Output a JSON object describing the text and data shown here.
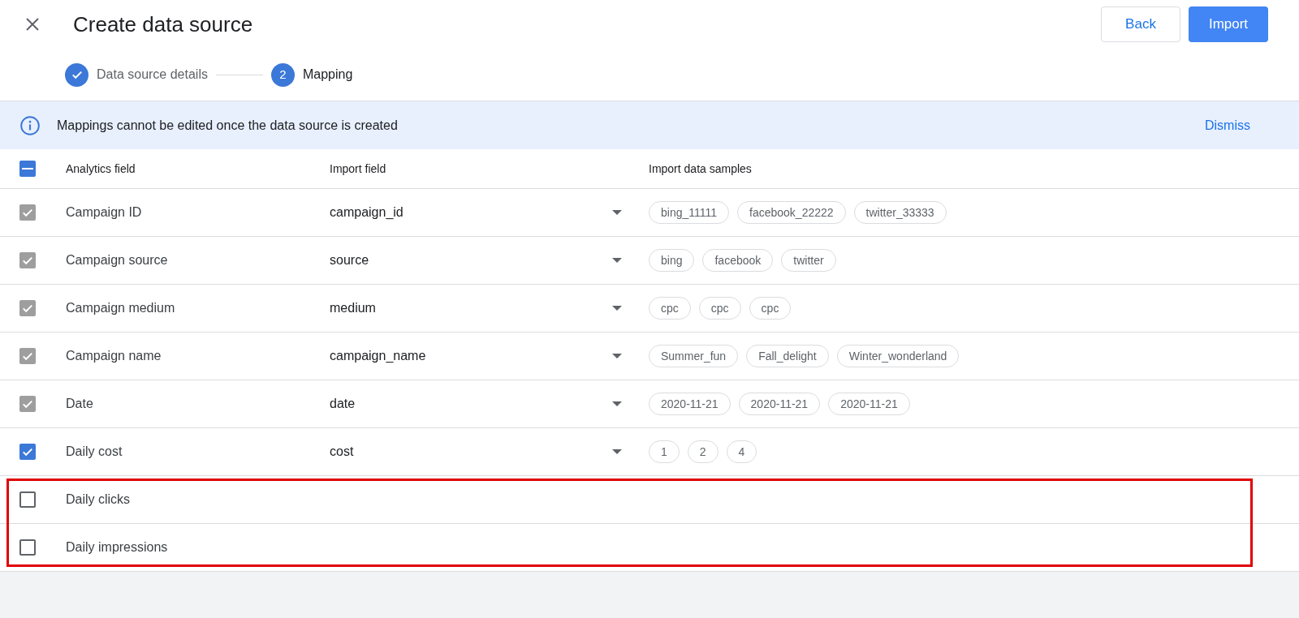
{
  "header": {
    "title": "Create data source",
    "buttons": [
      {
        "label": "Back",
        "kind": "outlined"
      },
      {
        "label": "Import",
        "kind": "filled"
      }
    ]
  },
  "steps": [
    {
      "label": "Data source details",
      "done": true,
      "selected": false
    },
    {
      "number": "2",
      "label": "Mapping",
      "done": false,
      "selected": true
    }
  ],
  "banner": {
    "message": "Mappings cannot be edited once the data source is created",
    "action": "Dismiss"
  },
  "table": {
    "select_all": {
      "checked": true,
      "indeterminate": true
    },
    "columns": [
      "Analytics field",
      "Import field",
      "Import data samples"
    ],
    "rows": [
      {
        "checked": true,
        "disabled": true,
        "highlighted": false,
        "analytics_field": "Campaign ID",
        "import_field": "campaign_id",
        "samples": [
          "bing_11111",
          "facebook_22222",
          "twitter_33333"
        ]
      },
      {
        "checked": true,
        "disabled": true,
        "highlighted": false,
        "analytics_field": "Campaign source",
        "import_field": "source",
        "samples": [
          "bing",
          "facebook",
          "twitter"
        ]
      },
      {
        "checked": true,
        "disabled": true,
        "highlighted": false,
        "analytics_field": "Campaign medium",
        "import_field": "medium",
        "samples": [
          "cpc",
          "cpc",
          "cpc"
        ]
      },
      {
        "checked": true,
        "disabled": true,
        "highlighted": false,
        "analytics_field": "Campaign name",
        "import_field": "campaign_name",
        "samples": [
          "Summer_fun",
          "Fall_delight",
          "Winter_wonderland"
        ]
      },
      {
        "checked": true,
        "disabled": true,
        "highlighted": false,
        "analytics_field": "Date",
        "import_field": "date",
        "samples": [
          "2020-11-21",
          "2020-11-21",
          "2020-11-21"
        ]
      },
      {
        "checked": true,
        "disabled": false,
        "highlighted": false,
        "analytics_field": "Daily cost",
        "import_field": "cost",
        "samples": [
          "1",
          "2",
          "4"
        ]
      },
      {
        "checked": false,
        "disabled": false,
        "highlighted": true,
        "analytics_field": "Daily clicks"
      },
      {
        "checked": false,
        "disabled": false,
        "highlighted": true,
        "analytics_field": "Daily impressions"
      }
    ]
  }
}
